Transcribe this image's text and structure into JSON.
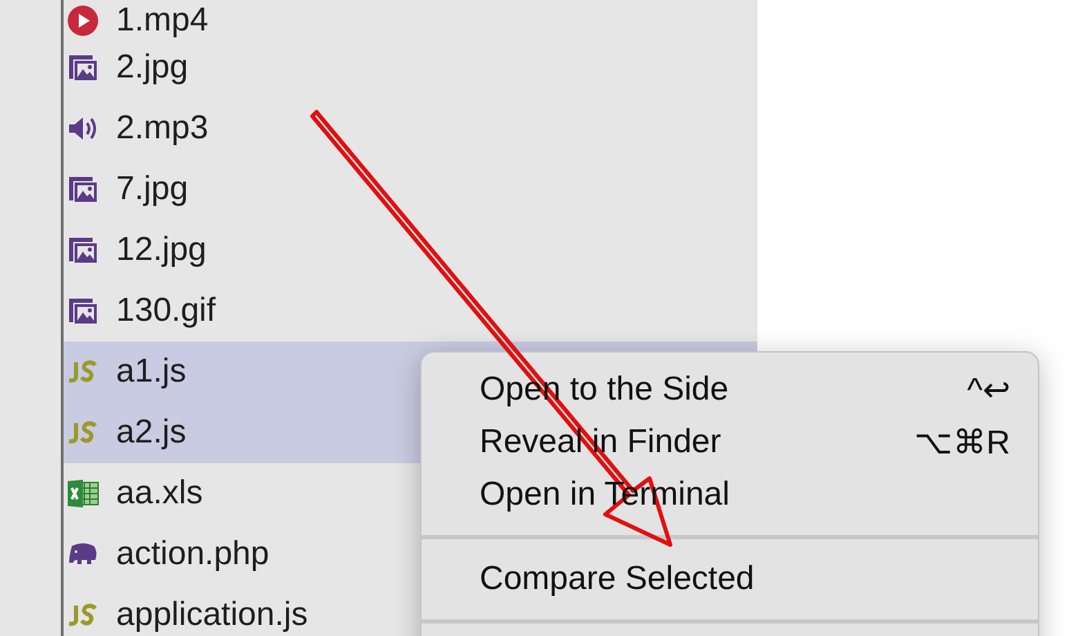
{
  "files": [
    {
      "name": "1.mp4",
      "kind": "video",
      "selected": false
    },
    {
      "name": "2.jpg",
      "kind": "image",
      "selected": false
    },
    {
      "name": "2.mp3",
      "kind": "audio",
      "selected": false
    },
    {
      "name": "7.jpg",
      "kind": "image",
      "selected": false
    },
    {
      "name": "12.jpg",
      "kind": "image",
      "selected": false
    },
    {
      "name": "130.gif",
      "kind": "image",
      "selected": false
    },
    {
      "name": "a1.js",
      "kind": "js",
      "selected": true
    },
    {
      "name": "a2.js",
      "kind": "js",
      "selected": true
    },
    {
      "name": "aa.xls",
      "kind": "excel",
      "selected": false
    },
    {
      "name": "action.php",
      "kind": "php",
      "selected": false
    },
    {
      "name": "application.js",
      "kind": "js",
      "selected": false
    }
  ],
  "context_menu": {
    "groups": [
      {
        "items": [
          {
            "label": "Open to the Side",
            "shortcut": "^↩"
          },
          {
            "label": "Reveal in Finder",
            "shortcut": "⌥⌘R"
          },
          {
            "label": "Open in Terminal"
          }
        ]
      },
      {
        "items": [
          {
            "label": "Compare Selected"
          }
        ]
      }
    ]
  }
}
